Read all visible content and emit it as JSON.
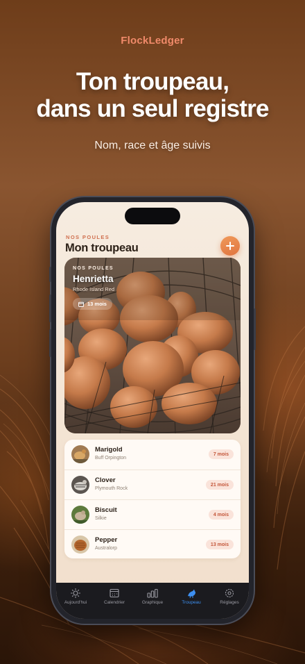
{
  "brand": "FlockLedger",
  "headline_line1": "Ton troupeau,",
  "headline_line2": "dans un seul registre",
  "subheadline": "Nom, race et âge suivis",
  "screen": {
    "eyebrow": "NOS POULES",
    "title": "Mon troupeau",
    "add_icon": "plus-icon",
    "featured": {
      "eyebrow": "NOS POULES",
      "name": "Henrietta",
      "breed": "Rhode Island Red",
      "age": "13 mois",
      "age_icon": "calendar-icon",
      "image": "basket of brown eggs"
    },
    "hens": [
      {
        "name": "Marigold",
        "breed": "Buff Orpington",
        "age": "7 mois"
      },
      {
        "name": "Clover",
        "breed": "Plymouth Rock",
        "age": "21 mois"
      },
      {
        "name": "Biscuit",
        "breed": "Silkie",
        "age": "4 mois"
      },
      {
        "name": "Pepper",
        "breed": "Australorp",
        "age": "13 mois"
      }
    ]
  },
  "tabs": [
    {
      "label": "Aujourd'hui",
      "icon": "sun-icon",
      "active": false
    },
    {
      "label": "Calendrier",
      "icon": "calendar-icon",
      "active": false
    },
    {
      "label": "Graphique",
      "icon": "bar-chart-icon",
      "active": false
    },
    {
      "label": "Troupeau",
      "icon": "bird-icon",
      "active": true
    },
    {
      "label": "Réglages",
      "icon": "gear-icon",
      "active": false
    }
  ],
  "colors": {
    "accent": "#e07440",
    "brand": "#f08a6a",
    "tab_active": "#3d8ff0",
    "badge_bg": "#fae3da",
    "badge_text": "#c4573a"
  }
}
